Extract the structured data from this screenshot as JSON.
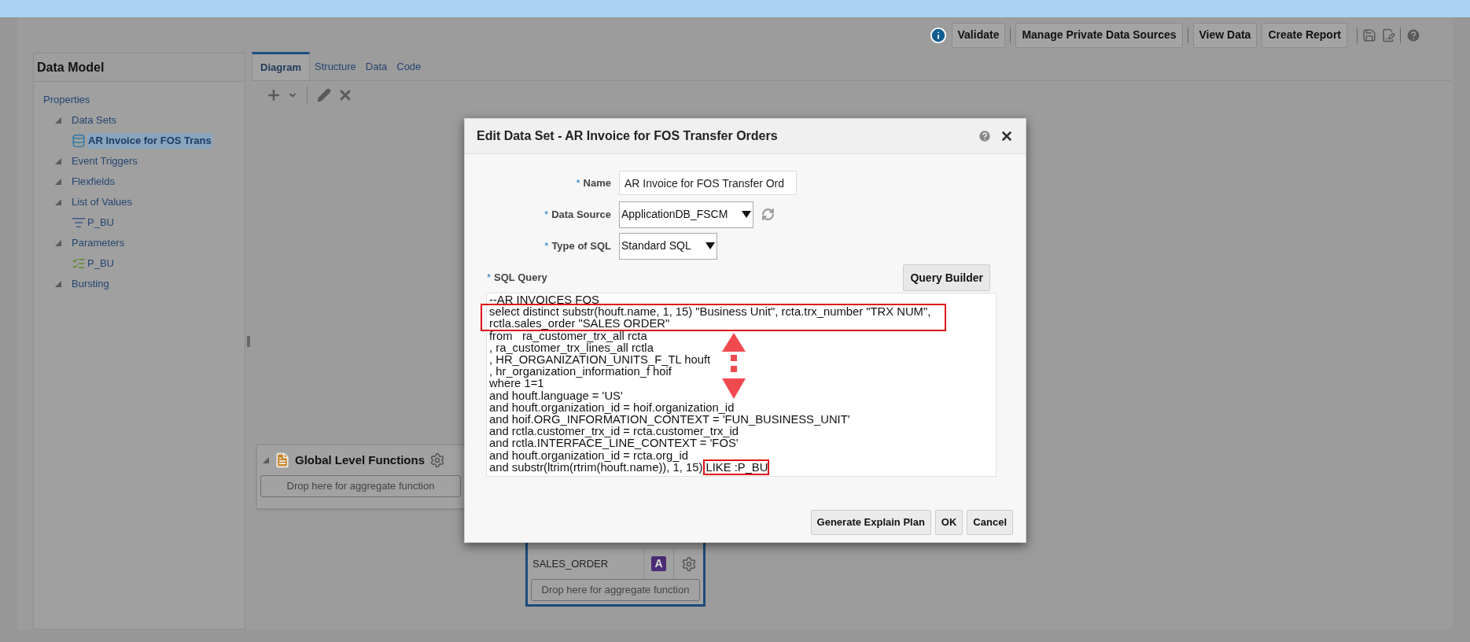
{
  "toolbar": {
    "buttons": [
      "Validate",
      "Manage Private Data Sources",
      "View Data",
      "Create Report"
    ]
  },
  "sidebar": {
    "title": "Data Model",
    "items": [
      {
        "label": "Properties",
        "kind": "link"
      },
      {
        "label": "Data Sets",
        "kind": "section",
        "expanded": true,
        "children": [
          {
            "label": "AR Invoice for FOS Trans",
            "kind": "data-set",
            "selected": true
          }
        ]
      },
      {
        "label": "Event Triggers",
        "kind": "section",
        "expanded": true
      },
      {
        "label": "Flexfields",
        "kind": "section",
        "expanded": true
      },
      {
        "label": "List of Values",
        "kind": "section",
        "expanded": true,
        "children": [
          {
            "label": "P_BU",
            "kind": "lov",
            "selected": false
          }
        ]
      },
      {
        "label": "Parameters",
        "kind": "section",
        "expanded": true,
        "children": [
          {
            "label": "P_BU",
            "kind": "parameter",
            "selected": false
          }
        ]
      },
      {
        "label": "Bursting",
        "kind": "section",
        "expanded": true
      }
    ]
  },
  "tabs": [
    {
      "label": "Diagram",
      "selected": true
    },
    {
      "label": "Structure",
      "selected": false
    },
    {
      "label": "Data",
      "selected": false
    },
    {
      "label": "Code",
      "selected": false
    }
  ],
  "canvas": {
    "global_functions": {
      "title": "Global Level Functions",
      "drop_text": "Drop here for aggregate function"
    },
    "data_set_box": {
      "element": "SALES_ORDER",
      "type_badge": "A",
      "drop_text": "Drop here for aggregate function"
    }
  },
  "dialog": {
    "title": "Edit Data Set - AR Invoice for FOS Transfer Orders",
    "fields": [
      {
        "marker": "*",
        "label": "Name",
        "kind": "text",
        "value": "AR Invoice for FOS Transfer Ord"
      },
      {
        "marker": "*",
        "label": "Data Source",
        "kind": "select",
        "value": "ApplicationDB_FSCM",
        "refresh": true
      },
      {
        "marker": "*",
        "label": "Type of SQL",
        "kind": "select",
        "value": "Standard SQL",
        "refresh": false
      }
    ],
    "sql_marker": "*",
    "sql_label": "SQL Query",
    "query_builder": "Query Builder",
    "sql": "--AR INVOICES FOS\nselect distinct substr(houft.name, 1, 15) \"Business Unit\", rcta.trx_number \"TRX NUM\",\nrctla.sales_order \"SALES ORDER\"\nfrom   ra_customer_trx_all rcta\n, ra_customer_trx_lines_all rctla\n, HR_ORGANIZATION_UNITS_F_TL houft\n, hr_organization_information_f hoif\nwhere 1=1\nand houft.language = 'US'\nand houft.organization_id = hoif.organization_id\nand hoif.ORG_INFORMATION_CONTEXT = 'FUN_BUSINESS_UNIT'\nand rctla.customer_trx_id = rcta.customer_trx_id\nand rctla.INTERFACE_LINE_CONTEXT = 'FOS'\nand houft.organization_id = rcta.org_id\nand substr(ltrim(rtrim(houft.name)), 1, 15) LIKE :P_BU",
    "buttons": [
      "Generate Explain Plan",
      "OK",
      "Cancel"
    ]
  }
}
